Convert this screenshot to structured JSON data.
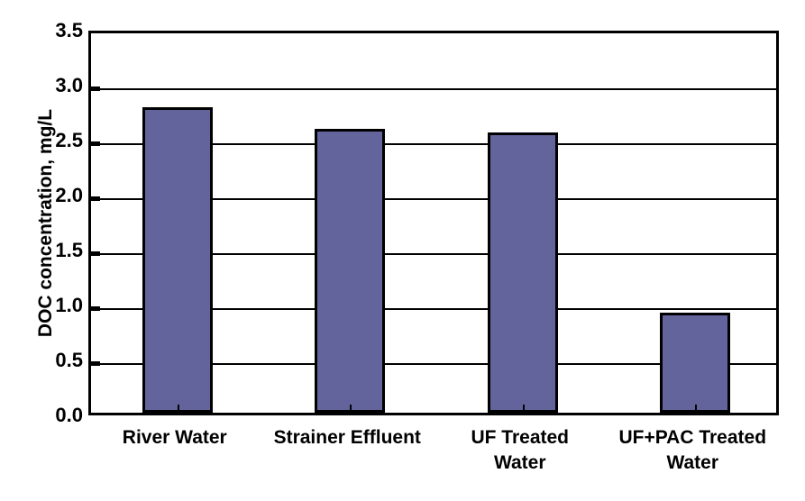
{
  "chart_data": {
    "type": "bar",
    "title": "",
    "subtitle": "",
    "xlabel": "",
    "ylabel": "DOC concentration, mg/L",
    "categories": [
      "River Water",
      "Strainer Effluent",
      "UF Treated\nWater",
      "UF+PAC Treated\nWater"
    ],
    "category_lines": [
      [
        "River Water"
      ],
      [
        "Strainer Effluent"
      ],
      [
        "UF Treated",
        "Water"
      ],
      [
        "UF+PAC Treated",
        "Water"
      ]
    ],
    "values": [
      2.78,
      2.58,
      2.55,
      0.91
    ],
    "ylim": [
      0.0,
      3.5
    ],
    "ytick_values": [
      0.0,
      0.5,
      1.0,
      1.5,
      2.0,
      2.5,
      3.0,
      3.5
    ],
    "ytick_labels": [
      "0.0",
      "0.5",
      "1.0",
      "1.5",
      "2.0",
      "2.5",
      "3.0",
      "3.5"
    ],
    "grid": "horizontal",
    "legend": "none",
    "bar_color": "#63649B",
    "bar_edge_color": "#000000",
    "axis_color": "#000000",
    "background_color": "#ffffff",
    "annotations": []
  }
}
